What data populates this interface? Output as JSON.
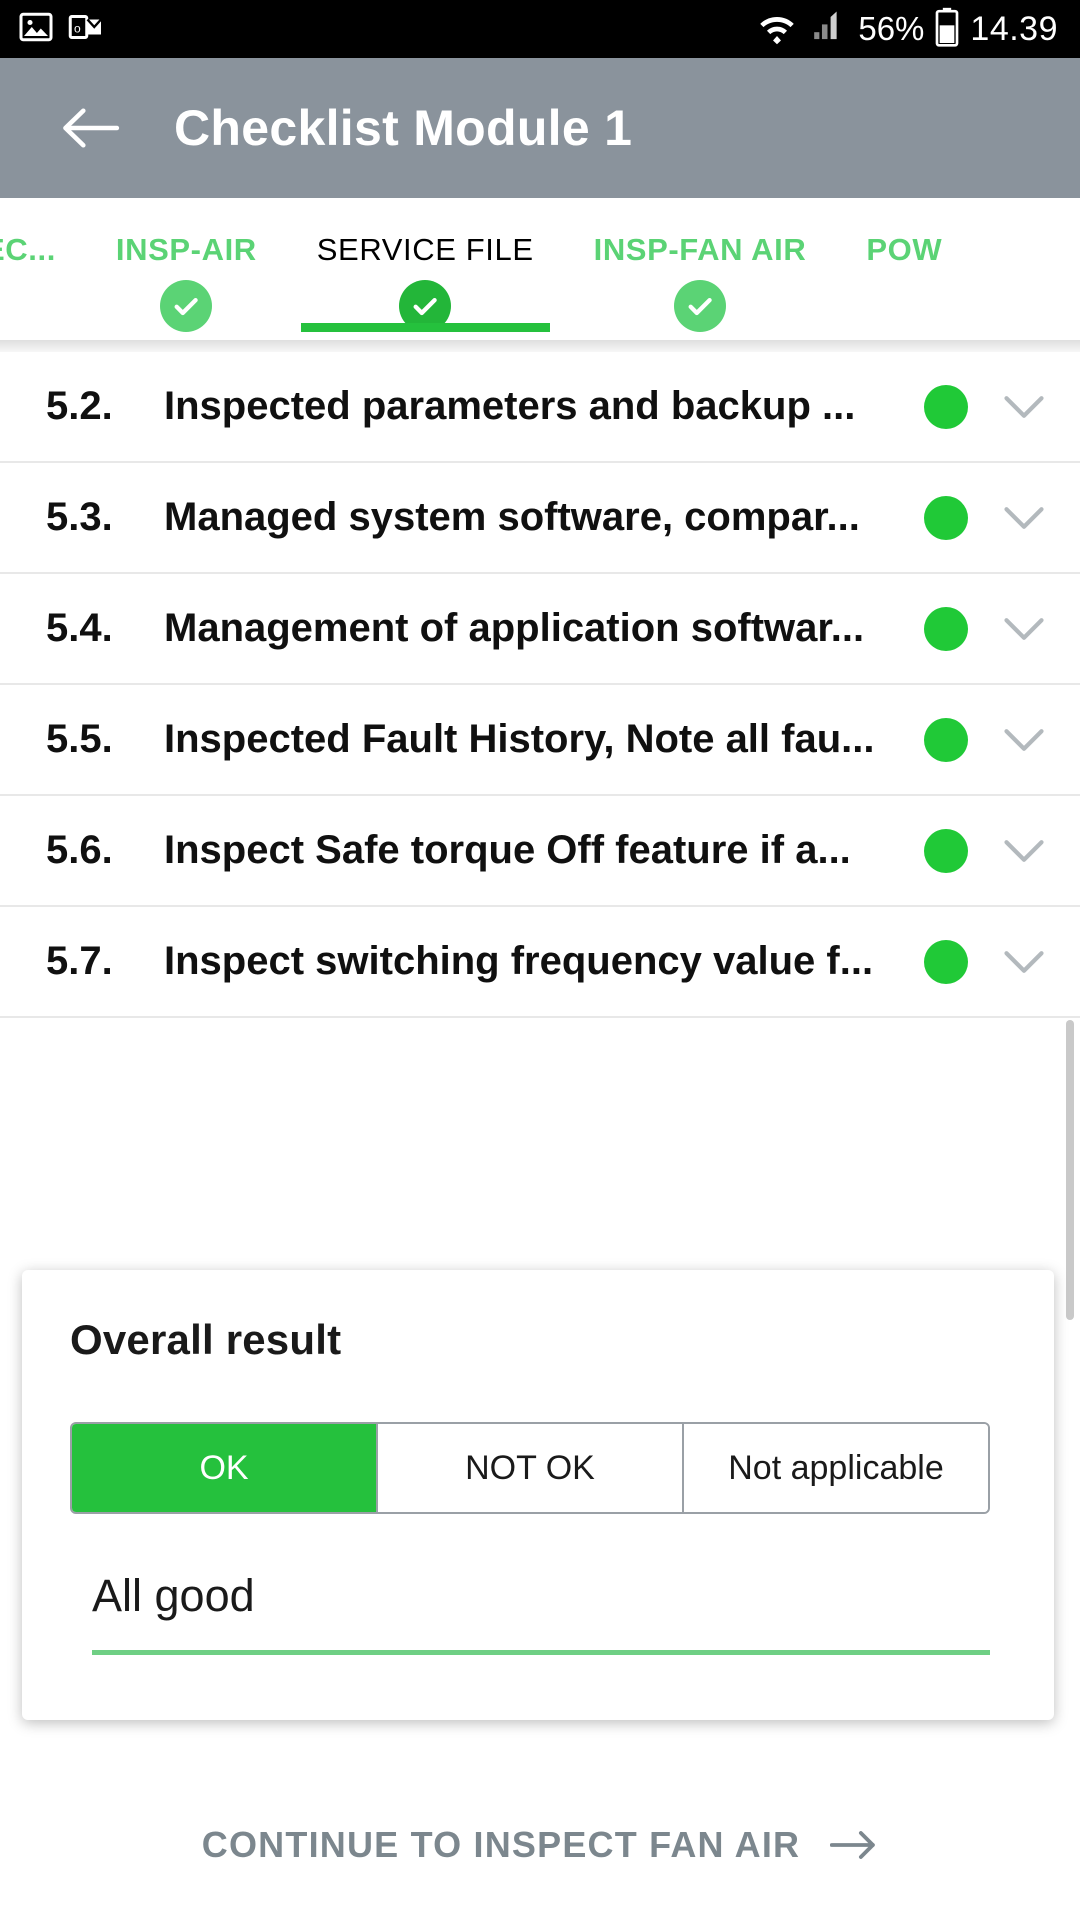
{
  "status_bar": {
    "icons": [
      "gallery-icon",
      "outlook-icon"
    ],
    "wifi": "wifi-icon",
    "cellular": "cellular-signal-icon",
    "battery_percent": "56%",
    "battery": "battery-icon",
    "time": "14.39"
  },
  "app_bar": {
    "back": "back-arrow-icon",
    "title": "Checklist Module 1",
    "background_color": "#8a939c"
  },
  "tabs": {
    "active_index": 2,
    "items": [
      {
        "label": "EC...",
        "checked": true
      },
      {
        "label": "INSP-AIR",
        "checked": true
      },
      {
        "label": "SERVICE FILE",
        "checked": true
      },
      {
        "label": "INSP-FAN AIR",
        "checked": true
      },
      {
        "label": "POW",
        "checked": true
      }
    ],
    "indicator_color": "#25c13d",
    "inactive_color": "#5bd375",
    "active_color": "#000000"
  },
  "checklist": {
    "rows": [
      {
        "number": "5.2.",
        "text": "Inspected parameters and backup ...",
        "status": "ok",
        "expand": "chevron-down-icon"
      },
      {
        "number": "5.3.",
        "text": "Managed system software, compar...",
        "status": "ok",
        "expand": "chevron-down-icon"
      },
      {
        "number": "5.4.",
        "text": "Management of application softwar...",
        "status": "ok",
        "expand": "chevron-down-icon"
      },
      {
        "number": "5.5.",
        "text": "Inspected Fault History, Note all fau...",
        "status": "ok",
        "expand": "chevron-down-icon"
      },
      {
        "number": "5.6.",
        "text": "Inspect Safe torque Off feature if a...",
        "status": "ok",
        "expand": "chevron-down-icon"
      },
      {
        "number": "5.7.",
        "text": "Inspect switching frequency value f...",
        "status": "ok",
        "expand": "chevron-down-icon"
      }
    ],
    "status_ok_color": "#20c937"
  },
  "overall_result": {
    "title": "Overall result",
    "options": [
      "OK",
      "NOT OK",
      "Not applicable"
    ],
    "selected": "OK",
    "selected_color": "#25c13d",
    "note_value": "All good",
    "note_underline_color": "#6fcf84"
  },
  "bottom_action": {
    "label": "CONTINUE TO INSPECT FAN AIR",
    "arrow": "arrow-right-icon",
    "color": "#7c878e"
  }
}
